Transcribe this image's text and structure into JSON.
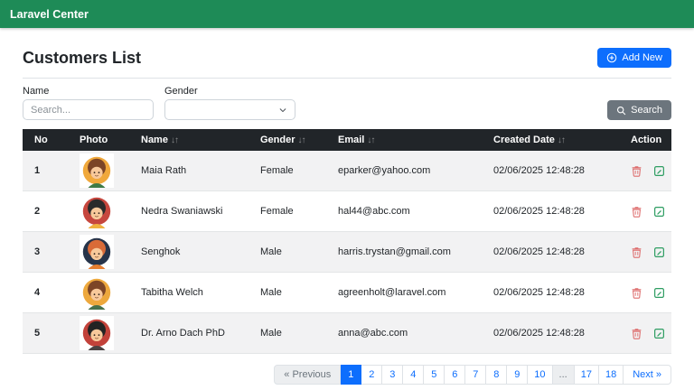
{
  "navbar": {
    "brand": "Laravel Center",
    "bg_color": "#1e8b57"
  },
  "page": {
    "title": "Customers List"
  },
  "toolbar": {
    "add_new_label": "Add New",
    "add_new_color": "#0d6efd",
    "add_new_icon": "plus-circle-icon"
  },
  "filters": {
    "name_label": "Name",
    "name_placeholder": "Search...",
    "name_value": "",
    "gender_label": "Gender",
    "gender_selected_value": "",
    "search_button_label": "Search",
    "search_button_color": "#6c757d",
    "search_button_icon": "magnifier-icon",
    "gender_dropdown_icon": "chevron-down-icon"
  },
  "table": {
    "header_bg": "#212529",
    "sort_icon": "↓↑",
    "columns": [
      {
        "label": "No",
        "sortable": false
      },
      {
        "label": "Photo",
        "sortable": false
      },
      {
        "label": "Name",
        "sortable": true
      },
      {
        "label": "Gender",
        "sortable": true
      },
      {
        "label": "Email",
        "sortable": true
      },
      {
        "label": "Created Date",
        "sortable": true
      },
      {
        "label": "Action",
        "sortable": false
      }
    ],
    "action_icons": {
      "delete": "trash-icon",
      "edit": "pencil-square-icon"
    },
    "action_colors": {
      "delete": "#dd6b6b",
      "edit": "#2f9e63"
    },
    "rows": [
      {
        "no": "1",
        "name": "Maia Rath",
        "gender": "Female",
        "email": "eparker@yahoo.com",
        "created": "02/06/2025 12:48:28",
        "avatar": {
          "bg": "#f0a83b",
          "hair": "#7c4526",
          "skin": "#f8c99b",
          "shirt": "#3d7a46"
        }
      },
      {
        "no": "2",
        "name": "Nedra Swaniawski",
        "gender": "Female",
        "email": "hal44@abc.com",
        "created": "02/06/2025 12:48:28",
        "avatar": {
          "bg": "#c6473e",
          "hair": "#2b2b2b",
          "skin": "#f8c99b",
          "shirt": "#f0b13e"
        }
      },
      {
        "no": "3",
        "name": "Senghok",
        "gender": "Male",
        "email": "harris.trystan@gmail.com",
        "created": "02/06/2025 12:48:28",
        "avatar": {
          "bg": "#27344a",
          "hair": "#d96b38",
          "skin": "#f8c99b",
          "shirt": "#e67e30"
        }
      },
      {
        "no": "4",
        "name": "Tabitha Welch",
        "gender": "Male",
        "email": "agreenholt@laravel.com",
        "created": "02/06/2025 12:48:28",
        "avatar": {
          "bg": "#eda83d",
          "hair": "#7c4526",
          "skin": "#f8c99b",
          "shirt": "#47714c"
        }
      },
      {
        "no": "5",
        "name": "Dr. Arno Dach PhD",
        "gender": "Male",
        "email": "anna@abc.com",
        "created": "02/06/2025 12:48:28",
        "avatar": {
          "bg": "#c2423a",
          "hair": "#232323",
          "skin": "#f8c99b",
          "shirt": "#4a4343"
        }
      }
    ]
  },
  "pagination": {
    "items": [
      {
        "label": "« Previous",
        "state": "disabled"
      },
      {
        "label": "1",
        "state": "active"
      },
      {
        "label": "2",
        "state": "link"
      },
      {
        "label": "3",
        "state": "link"
      },
      {
        "label": "4",
        "state": "link"
      },
      {
        "label": "5",
        "state": "link"
      },
      {
        "label": "6",
        "state": "link"
      },
      {
        "label": "7",
        "state": "link"
      },
      {
        "label": "8",
        "state": "link"
      },
      {
        "label": "9",
        "state": "link"
      },
      {
        "label": "10",
        "state": "link"
      },
      {
        "label": "...",
        "state": "disabled"
      },
      {
        "label": "17",
        "state": "link"
      },
      {
        "label": "18",
        "state": "link"
      },
      {
        "label": "Next »",
        "state": "link"
      }
    ]
  }
}
